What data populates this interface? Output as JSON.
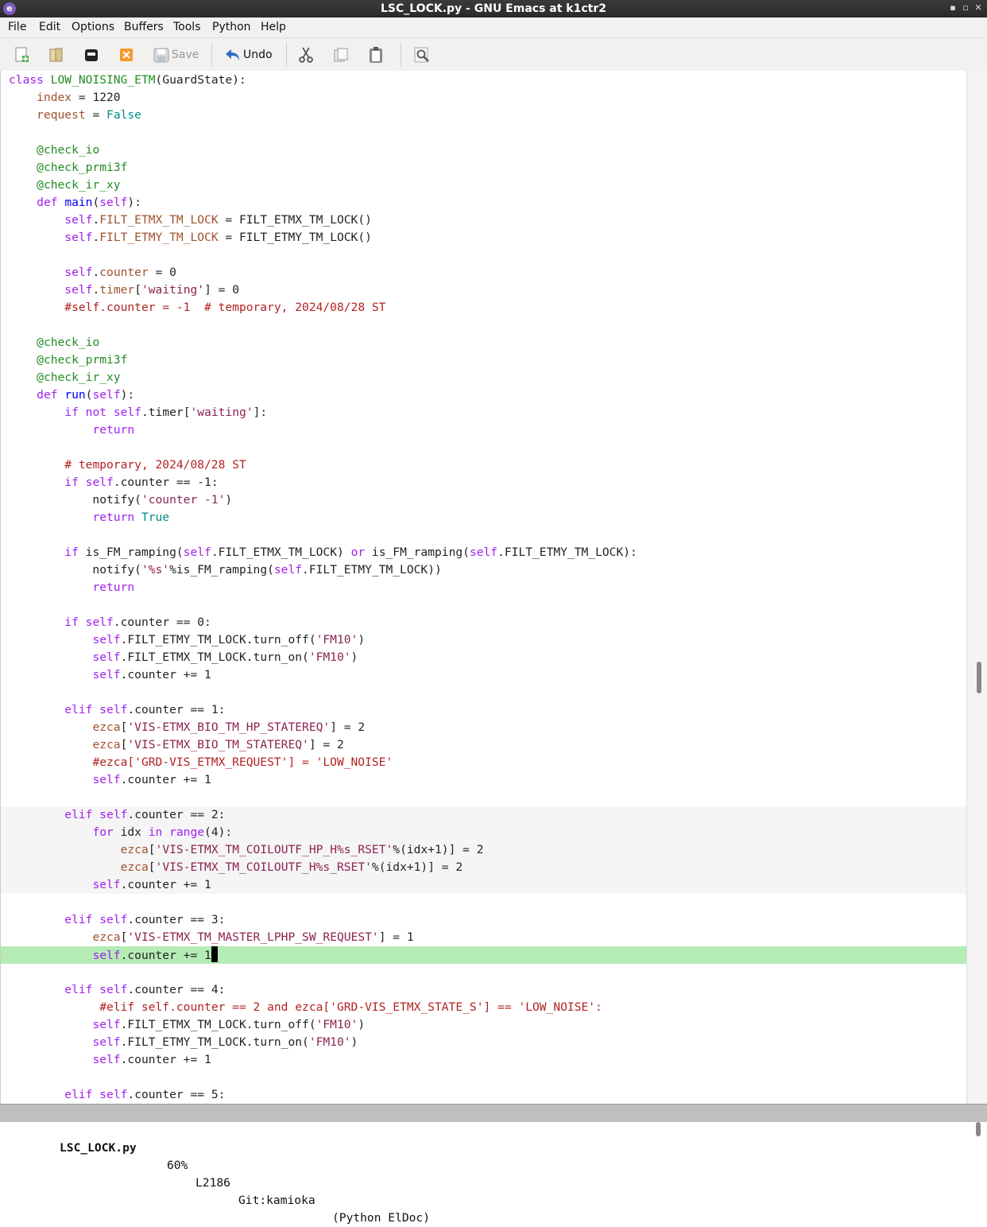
{
  "window": {
    "title": "LSC_LOCK.py - GNU Emacs at k1ctr2",
    "controls": [
      "▪",
      "▫",
      "✕"
    ]
  },
  "menu": {
    "items": [
      "File",
      "Edit",
      "Options",
      "Buffers",
      "Tools",
      "Python",
      "Help"
    ]
  },
  "toolbar": {
    "save_label": "Save",
    "undo_label": "Undo",
    "icons": [
      "new-file-icon",
      "open-folder-icon",
      "open-dired-icon",
      "close-buffer-icon",
      "save-icon",
      "undo-icon",
      "cut-icon",
      "copy-icon",
      "paste-icon",
      "search-icon"
    ]
  },
  "colors": {
    "keyword": "#a020f0",
    "function": "#0000ff",
    "type": "#228b22",
    "string": "#8b2252",
    "comment": "#b22222",
    "variable": "#a0522d",
    "constant": "#008b8b",
    "hl_line": "#b5ecb5"
  },
  "code": {
    "language": "Python",
    "lines": [
      "class LOW_NOISING_ETM(GuardState):",
      "    index = 1220",
      "    request = False",
      "",
      "    @check_io",
      "    @check_prmi3f",
      "    @check_ir_xy",
      "    def main(self):",
      "        self.FILT_ETMX_TM_LOCK = FILT_ETMX_TM_LOCK()",
      "        self.FILT_ETMY_TM_LOCK = FILT_ETMY_TM_LOCK()",
      "",
      "        self.counter = 0",
      "        self.timer['waiting'] = 0",
      "        #self.counter = -1  # temporary, 2024/08/28 ST",
      "",
      "    @check_io",
      "    @check_prmi3f",
      "    @check_ir_xy",
      "    def run(self):",
      "        if not self.timer['waiting']:",
      "            return",
      "",
      "        # temporary, 2024/08/28 ST",
      "        if self.counter == -1:",
      "            notify('counter -1')",
      "            return True",
      "",
      "        if is_FM_ramping(self.FILT_ETMX_TM_LOCK) or is_FM_ramping(self.FILT_ETMY_TM_LOCK):",
      "            notify('%s'%is_FM_ramping(self.FILT_ETMY_TM_LOCK))",
      "            return",
      "",
      "        if self.counter == 0:",
      "            self.FILT_ETMY_TM_LOCK.turn_off('FM10')",
      "            self.FILT_ETMX_TM_LOCK.turn_on('FM10')",
      "            self.counter += 1",
      "",
      "        elif self.counter == 1:",
      "            ezca['VIS-ETMX_BIO_TM_HP_STATEREQ'] = 2",
      "            ezca['VIS-ETMX_BIO_TM_STATEREQ'] = 2",
      "            #ezca['GRD-VIS_ETMX_REQUEST'] = 'LOW_NOISE'",
      "            self.counter += 1",
      "",
      "        elif self.counter == 2:",
      "            for idx in range(4):",
      "                ezca['VIS-ETMX_TM_COILOUTF_HP_H%s_RSET'%(idx+1)] = 2",
      "                ezca['VIS-ETMX_TM_COILOUTF_H%s_RSET'%(idx+1)] = 2",
      "            self.counter += 1",
      "",
      "        elif self.counter == 3:",
      "            ezca['VIS-ETMX_TM_MASTER_LPHP_SW_REQUEST'] = 1",
      "            self.counter += 1",
      "",
      "        elif self.counter == 4:",
      "             #elif self.counter == 2 and ezca['GRD-VIS_ETMX_STATE_S'] == 'LOW_NOISE':",
      "            self.FILT_ETMX_TM_LOCK.turn_off('FM10')",
      "            self.FILT_ETMY_TM_LOCK.turn_on('FM10')",
      "            self.counter += 1",
      "",
      "        elif self.counter == 5:"
    ]
  },
  "modeline": {
    "status": "-:---",
    "buffer": "LSC_LOCK.py",
    "position": "60%",
    "line": "L2186",
    "vc": "Git:kamioka",
    "modes": "(Python ElDoc)"
  }
}
